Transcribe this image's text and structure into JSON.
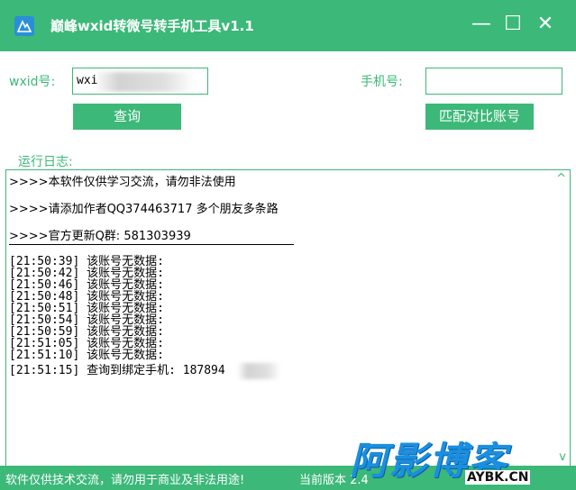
{
  "window": {
    "title": "巅峰wxid转微号转手机工具v1.1",
    "controls": {
      "minimize": "—",
      "maximize": "☐",
      "close": "✕"
    }
  },
  "form": {
    "wxid_label": "wxid号:",
    "wxid_value": "wxi",
    "phone_label": "手机号:",
    "phone_value": "",
    "query_button": "查询",
    "match_button": "匹配对比账号"
  },
  "log": {
    "section_label": "运行日志:",
    "header_lines": [
      ">>>>本软件仅供学习交流，请勿非法使用",
      ">>>>请添加作者QQ374463717 多个朋友多条路",
      ">>>>官方更新Q群: 581303939"
    ],
    "entries": [
      "[21:50:39]  该账号无数据:",
      "[21:50:42]  该账号无数据:",
      "[21:50:46]  该账号无数据:",
      "[21:50:48]  该账号无数据:",
      "[21:50:51]  该账号无数据:",
      "[21:50:54]  该账号无数据:",
      "[21:50:59]  该账号无数据:",
      "[21:51:05]  该账号无数据:",
      "[21:51:10]  该账号无数据:",
      "[21:51:15]  查询到绑定手机: 187894"
    ]
  },
  "status": {
    "left_text": "软件仅供技术交流，请勿用于商业及非法用途!",
    "right_text": "当前版本 2.4"
  },
  "watermark": {
    "main": "阿影博客",
    "sub": "AYBK.CN"
  },
  "colors": {
    "accent": "#3cb878",
    "watermark_blue": "#1a8fe0"
  }
}
